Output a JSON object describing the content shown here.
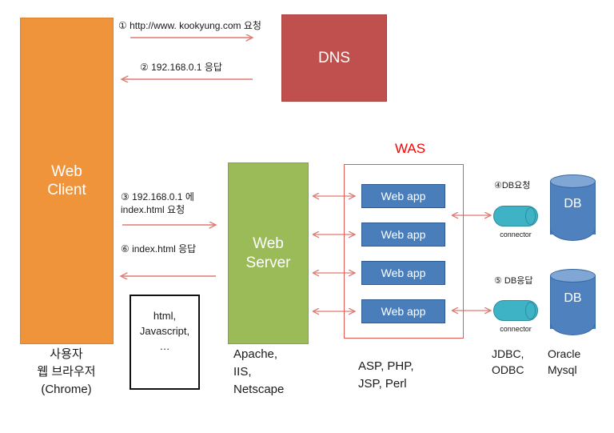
{
  "diagram": {
    "title": "Web Client / Web Server / WAS / DB architecture flow"
  },
  "nodes": {
    "web_client": {
      "label": "Web\nClient",
      "color": "#F0943C"
    },
    "dns": {
      "label": "DNS",
      "color": "#C0504D"
    },
    "web_server": {
      "label": "Web\nServer",
      "color": "#9BBB59"
    },
    "assets": {
      "label": "html,\nJavascript,\n…"
    },
    "was": {
      "title": "WAS",
      "frame_color": "#E05A52"
    },
    "web_apps": [
      {
        "label": "Web app"
      },
      {
        "label": "Web app"
      },
      {
        "label": "Web app"
      },
      {
        "label": "Web app"
      }
    ],
    "connectors": [
      {
        "label": "connector",
        "color": "#3FB3C6"
      },
      {
        "label": "connector",
        "color": "#3FB3C6"
      }
    ],
    "databases": [
      {
        "label": "DB",
        "color": "#4E81BD"
      },
      {
        "label": "DB",
        "color": "#4E81BD"
      }
    ]
  },
  "steps": {
    "step1": "① http://www. kookyung.com 요청",
    "step2": "② 192.168.0.1 응답",
    "step3": "③ 192.168.0.1 에\nindex.html 요청",
    "step6": "⑥ index.html 응답",
    "step4": "④DB요청",
    "step5": "⑤ DB응답"
  },
  "captions": {
    "client": "사용자\n웹 브라우저\n(Chrome)",
    "web_server": "Apache,\nIIS,\nNetscape",
    "was": "ASP, PHP,\nJSP, Perl",
    "connector": "JDBC,\nODBC",
    "database": "Oracle\nMysql"
  },
  "colors": {
    "arrow": "#E07A72",
    "was_red": "#FF0000",
    "orange": "#F0943C",
    "red": "#C0504D",
    "green": "#9BBB59",
    "blue": "#4A7EBB",
    "teal": "#3FB3C6",
    "db_blue": "#4E81BD"
  }
}
